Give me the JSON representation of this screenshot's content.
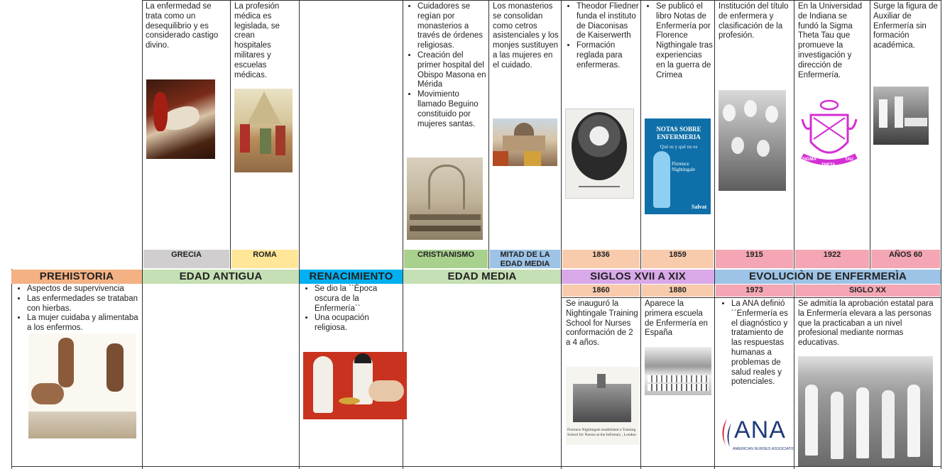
{
  "colors": {
    "prehistoria": "#f4b183",
    "edad_antigua": "#c5e0b4",
    "renacimiento": "#00b0f0",
    "edad_media": "#c5e0b4",
    "siglos": "#d9a8e8",
    "evolucion": "#9dc3e6",
    "grecia": "#d0cece",
    "roma": "#ffe699",
    "cristianismo": "#a9d18e",
    "mitad": "#9dc3e6",
    "y1836": "#f8cbad",
    "y1915": "#f4a6b4",
    "y1860": "#f8cbad",
    "y1973": "#f4a6b4",
    "sigma_theta": "#d42fd4",
    "ana_red": "#d7282f",
    "ana_blue": "#1f3b7a"
  },
  "eras": {
    "prehistoria": "PREHISTORIA",
    "edad_antigua": "EDAD ANTIGUA",
    "renacimiento": "RENACIMIENTO",
    "edad_media": "EDAD MEDIA",
    "siglos": "SIGLOS XVII A XIX",
    "evolucion": "EVOLUCIÒN DE ENFERMERÌA"
  },
  "top_years": {
    "grecia": "GRECIA",
    "roma": "ROMA",
    "cristianismo": "CRISTIANISMO",
    "mitad": "MITAD DE LA EDAD MEDIA",
    "y1836": "1836",
    "y1859": "1859",
    "y1915": "1915",
    "y1922": "1922",
    "y60": "AÑOS 60"
  },
  "bottom_years": {
    "y1860": "1860",
    "y1880": "1880",
    "y1973": "1973",
    "sigloxx": "SIGLO XX"
  },
  "top_text": {
    "grecia": "La enfermedad se trata como un desequilibrio y es considerado castigo divino.",
    "roma": "La profesión médica es legislada, se crean hospitales militares y escuelas médicas.",
    "cristianismo": [
      "Cuidadores se regían por monasterios a través de órdenes religiosas.",
      "Creación del primer hospital del Obispo Masona en Mérida",
      "Movimiento llamado Beguino constituido por mujeres santas."
    ],
    "mitad": "Los monasterios se consolidan como cetros asistenciales y los monjes sustituyen a las mujeres en el cuidado.",
    "y1836": [
      "Theodor Fliedner funda el instituto de Diaconisas de Kaiserwerth",
      "Formación reglada para enfermeras."
    ],
    "y1859": [
      "Se publicó el libro Notas de Enfermería por Florence Nigthingale tras experiencias en la guerra de Crimea"
    ],
    "y1915": "Institución del título de enfermera y clasificación de la profesión.",
    "y1922": "En la Universidad de Indiana se fundó la Sigma Theta Tau que promueve la investigación y dirección de Enfermería.",
    "y60": "Surge la figura de Auxiliar de Enfermería sin formación académica."
  },
  "bottom_text": {
    "prehistoria": [
      "Aspectos de supervivencia",
      "Las enfermedades se trataban con hierbas.",
      "La mujer cuidaba y alimentaba a los enfermos."
    ],
    "renacimiento": [
      "Se dio la ``Época oscura de la Enfermería``",
      "Una ocupación religiosa."
    ],
    "y1860": "Se inauguró la Nightingale Training School for Nurses conformación de 2 a 4 años.",
    "y1880": "Aparece la primera escuela de Enfermería en España",
    "y1973": [
      "La ANA definió ´´Enfermería es el diagnóstico y tratamiento de las respuestas humanas a problemas de salud reales y potenciales."
    ],
    "sigloxx": "Se admitía la aprobación estatal para la Enfermería elevara a las personas que la practicaban a un nivel profesional mediante normas educativas."
  },
  "images": {
    "book_title": "NOTAS SOBRE ENFERMERIA",
    "book_subtitle": "Qué es y qué no es",
    "book_author": "Florence Nightingale",
    "book_publisher": "Salvat",
    "sigma_words": [
      "SIGMA",
      "THETA",
      "TAU"
    ],
    "ana_logo": "ANA",
    "ana_caption": "AMERICAN NURSES ASSOCIATION",
    "nightingale_caption": "Florence Nightingale established a Training School for Nurses at the Infirmary , London"
  }
}
